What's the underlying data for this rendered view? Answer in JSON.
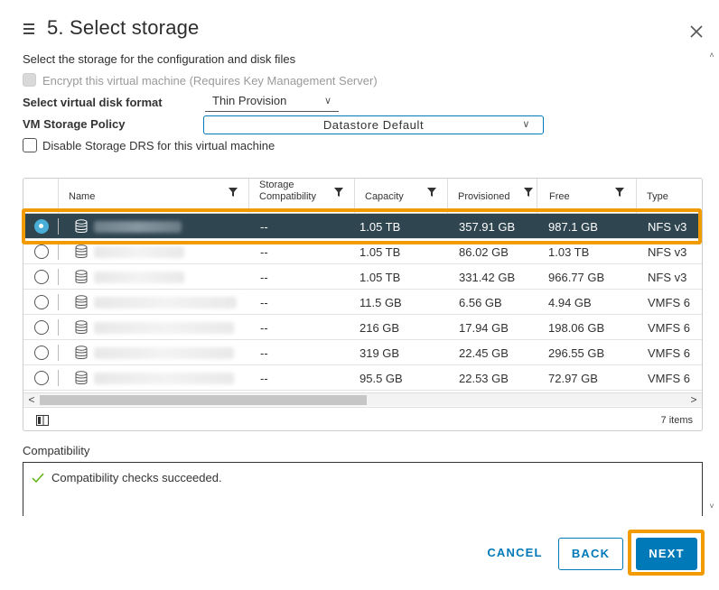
{
  "header": {
    "title": "5. Select storage",
    "subtitle": "Select the storage for the configuration and disk files"
  },
  "form": {
    "encrypt_label": "Encrypt this virtual machine (Requires Key Management Server)",
    "disk_format_label": "Select virtual disk format",
    "disk_format_value": "Thin Provision",
    "policy_label": "VM Storage Policy",
    "policy_value": "Datastore Default",
    "drs_label": "Disable Storage DRS for this virtual machine"
  },
  "grid": {
    "columns": {
      "name": "Name",
      "compat_line1": "Storage",
      "compat_line2": "Compatibility",
      "capacity": "Capacity",
      "provisioned": "Provisioned",
      "free": "Free",
      "type": "Type"
    },
    "rows": [
      {
        "compat": "--",
        "capacity": "1.05 TB",
        "provisioned": "357.91 GB",
        "free": "987.1 GB",
        "type": "NFS v3",
        "selected": true
      },
      {
        "compat": "--",
        "capacity": "1.05 TB",
        "provisioned": "86.02 GB",
        "free": "1.03 TB",
        "type": "NFS v3",
        "selected": false
      },
      {
        "compat": "--",
        "capacity": "1.05 TB",
        "provisioned": "331.42 GB",
        "free": "966.77 GB",
        "type": "NFS v3",
        "selected": false
      },
      {
        "compat": "--",
        "capacity": "11.5 GB",
        "provisioned": "6.56 GB",
        "free": "4.94 GB",
        "type": "VMFS 6",
        "selected": false
      },
      {
        "compat": "--",
        "capacity": "216 GB",
        "provisioned": "17.94 GB",
        "free": "198.06 GB",
        "type": "VMFS 6",
        "selected": false
      },
      {
        "compat": "--",
        "capacity": "319 GB",
        "provisioned": "22.45 GB",
        "free": "296.55 GB",
        "type": "VMFS 6",
        "selected": false
      },
      {
        "compat": "--",
        "capacity": "95.5 GB",
        "provisioned": "22.53 GB",
        "free": "72.97 GB",
        "type": "VMFS 6",
        "selected": false
      }
    ],
    "items_count": "7 items"
  },
  "compatibility": {
    "label": "Compatibility",
    "message": "Compatibility checks succeeded."
  },
  "footer": {
    "cancel": "CANCEL",
    "back": "BACK",
    "next": "NEXT"
  },
  "colors": {
    "accent": "#0079b8",
    "selected_row": "#2f4550",
    "highlight": "#f29b00",
    "success": "#60b515"
  }
}
